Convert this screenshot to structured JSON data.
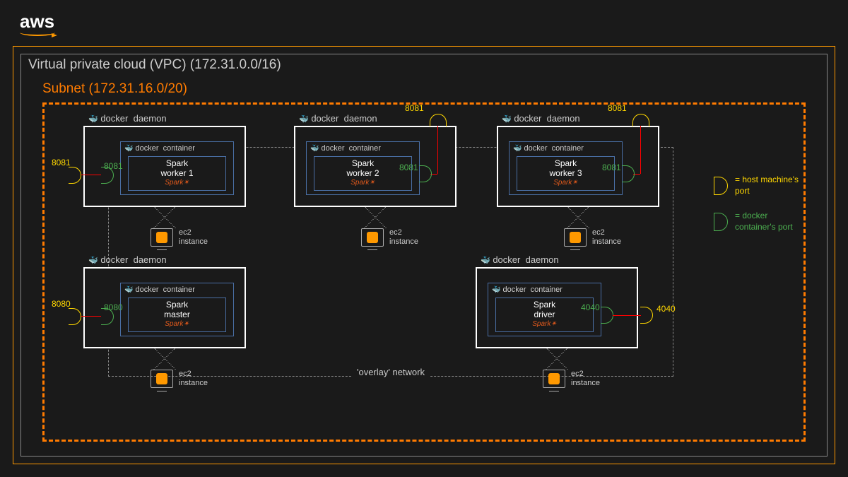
{
  "logo": "aws",
  "vpc": {
    "title": "Virtual private cloud (VPC) (172.31.0.0/16)"
  },
  "subnet": {
    "title": "Subnet (172.31.16.0/20)"
  },
  "overlay": {
    "label": "'overlay' network"
  },
  "daemon_label": "daemon",
  "docker_label": "docker",
  "container_label": "container",
  "ec2_label": "ec2\ninstance",
  "nodes": {
    "worker1": {
      "title": "Spark\nworker 1",
      "host_port": "8081",
      "docker_port": "8081"
    },
    "worker2": {
      "title": "Spark\nworker 2",
      "host_port": "8081",
      "docker_port": "8081"
    },
    "worker3": {
      "title": "Spark\nworker 3",
      "host_port": "8081",
      "docker_port": "8081"
    },
    "master": {
      "title": "Spark\nmaster",
      "host_port": "8080",
      "docker_port": "8080"
    },
    "driver": {
      "title": "Spark\ndriver",
      "host_port": "4040",
      "docker_port": "4040"
    }
  },
  "spark_brand": "Spark✴",
  "legend": {
    "host": "= host machine's\nport",
    "docker": "= docker\ncontainer's port"
  }
}
